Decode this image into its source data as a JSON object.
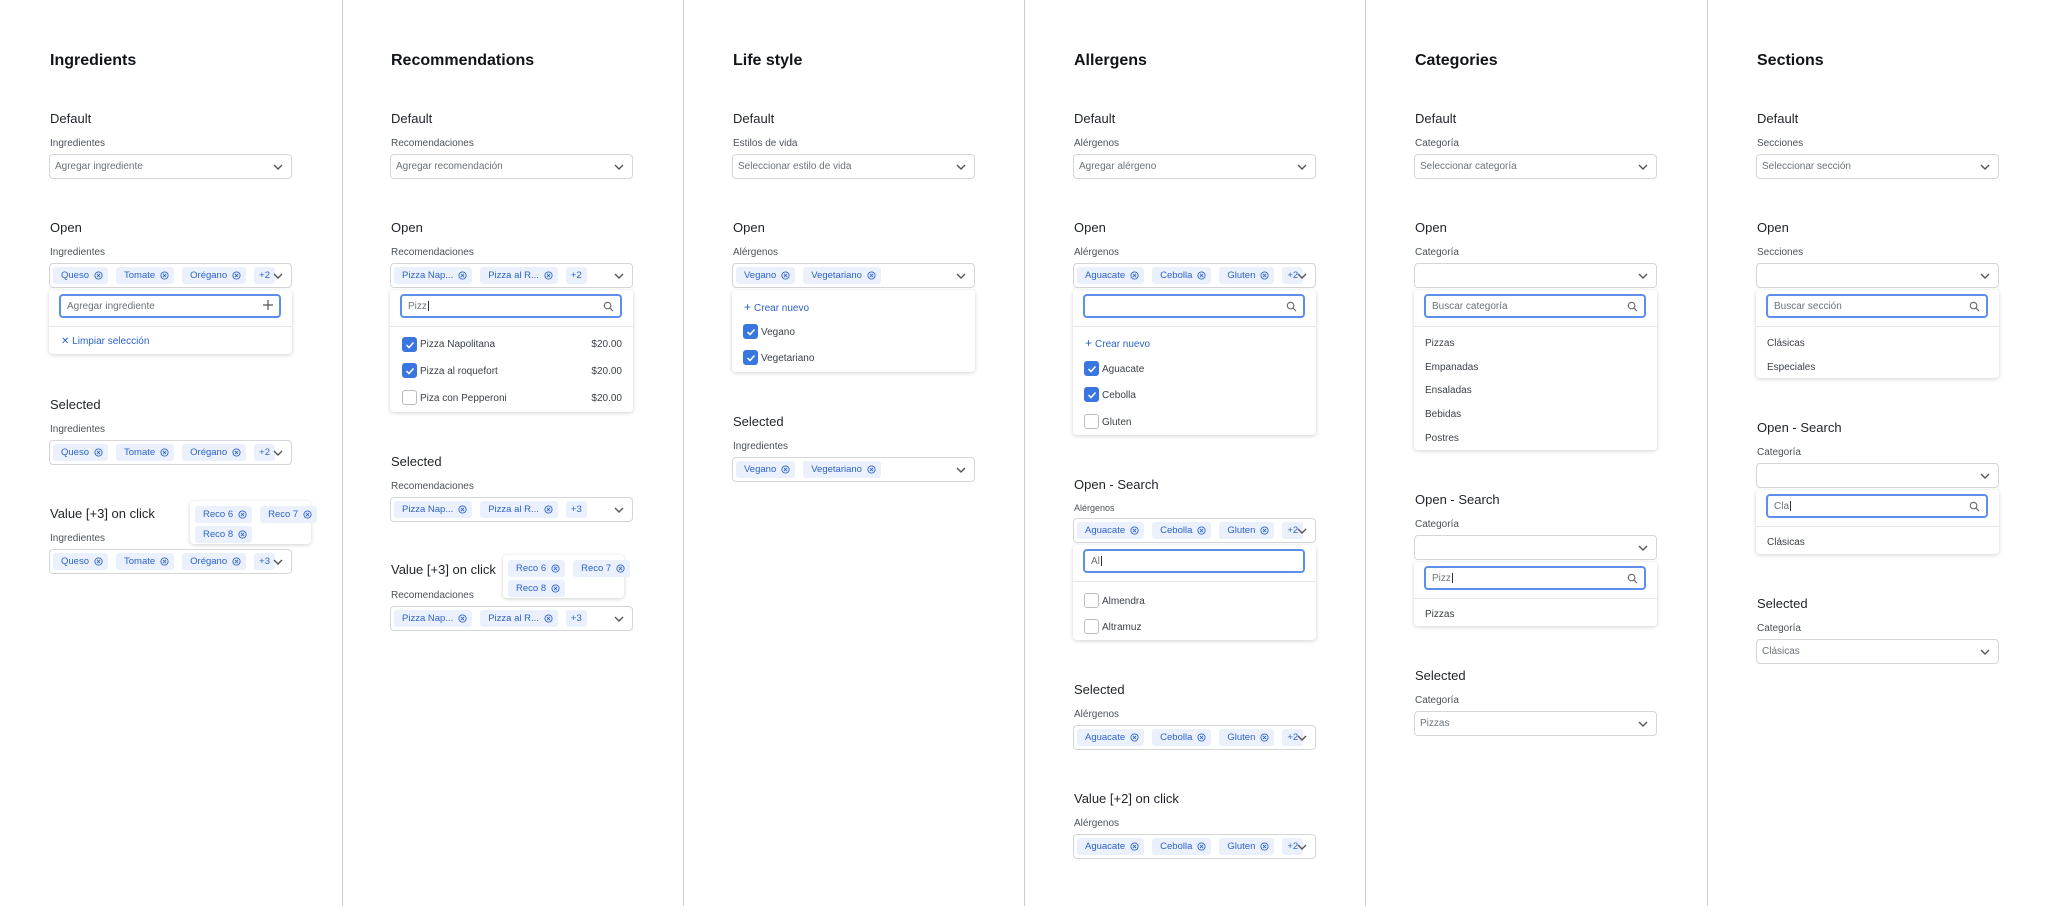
{
  "colors": {
    "accent": "#3a76e0",
    "chip_bg": "#eaf1fd",
    "chip_text": "#2d62c9",
    "divider": "#c9cdd2"
  },
  "icons": {
    "chevron": "chevron-down-icon",
    "chip_remove": "x-circle-icon",
    "search": "search-icon",
    "check": "check-icon",
    "plus": "plus-icon",
    "close": "close-icon"
  },
  "ingredients": {
    "title": "Ingredients",
    "default": {
      "heading": "Default",
      "label": "Ingredientes",
      "placeholder": "Agregar ingrediente"
    },
    "open": {
      "heading": "Open",
      "label": "Ingredientes",
      "chips": [
        "Queso",
        "Tomate",
        "Orégano"
      ],
      "more": "+2",
      "search_placeholder": "Agregar ingrediente",
      "clear": "Limpiar selección"
    },
    "selected": {
      "heading": "Selected",
      "label": "Ingredientes",
      "chips": [
        "Queso",
        "Tomate",
        "Orégano"
      ],
      "more": "+2"
    },
    "value_click": {
      "heading": "Value [+3] on click",
      "label": "Ingredientes",
      "chips": [
        "Queso",
        "Tomate",
        "Orégano"
      ],
      "more": "+3",
      "popover": [
        "Reco 6",
        "Reco 7",
        "Reco 8"
      ]
    }
  },
  "recommendations": {
    "title": "Recommendations",
    "default": {
      "heading": "Default",
      "label": "Recomendaciones",
      "placeholder": "Agregar recomendación"
    },
    "open": {
      "heading": "Open",
      "label": "Recomendaciones",
      "chips": [
        "Pizza Nap...",
        "Pizza al R..."
      ],
      "more": "+2",
      "search_typed": "Pizz",
      "options": [
        {
          "name": "Pizza Napolitana",
          "price": "$20.00",
          "checked": true
        },
        {
          "name": "Pizza al roquefort",
          "price": "$20.00",
          "checked": true
        },
        {
          "name": "Piza con Pepperoni",
          "price": "$20.00",
          "checked": false
        }
      ]
    },
    "selected": {
      "heading": "Selected",
      "label": "Recomendaciones",
      "chips": [
        "Pizza Nap...",
        "Pizza al R..."
      ],
      "more": "+3"
    },
    "value_click": {
      "heading": "Value [+3] on click",
      "label": "Recomendaciones",
      "chips": [
        "Pizza Nap...",
        "Pizza al R..."
      ],
      "more": "+3",
      "popover": [
        "Reco 6",
        "Reco 7",
        "Reco 8"
      ]
    }
  },
  "lifestyle": {
    "title": "Life style",
    "default": {
      "heading": "Default",
      "label": "Estilos de vida",
      "placeholder": "Seleccionar estilo de vida"
    },
    "open": {
      "heading": "Open",
      "label": "Alérgenos",
      "chips": [
        "Vegano",
        "Vegetariano"
      ],
      "create": "Crear nuevo",
      "options": [
        {
          "name": "Vegano",
          "checked": true
        },
        {
          "name": "Vegetariano",
          "checked": true
        }
      ]
    },
    "selected": {
      "heading": "Selected",
      "label": "Ingredientes",
      "chips": [
        "Vegano",
        "Vegetariano"
      ]
    }
  },
  "allergens": {
    "title": "Allergens",
    "default": {
      "heading": "Default",
      "label": "Alérgenos",
      "placeholder": "Agregar alérgeno"
    },
    "open": {
      "heading": "Open",
      "label": "Alérgenos",
      "chips": [
        "Aguacate",
        "Cebolla",
        "Gluten"
      ],
      "more": "+2",
      "create": "Crear nuevo",
      "options": [
        {
          "name": "Aguacate",
          "checked": true
        },
        {
          "name": "Cebolla",
          "checked": true
        },
        {
          "name": "Gluten",
          "checked": false
        }
      ]
    },
    "open_search": {
      "heading": "Open - Search",
      "label": "Alérgenos",
      "chips": [
        "Aguacate",
        "Cebolla",
        "Gluten"
      ],
      "more": "+2",
      "search_typed": "Al",
      "options": [
        {
          "name": "Almendra",
          "checked": false
        },
        {
          "name": "Altramuz",
          "checked": false
        }
      ]
    },
    "selected": {
      "heading": "Selected",
      "label": "Alérgenos",
      "chips": [
        "Aguacate",
        "Cebolla",
        "Gluten"
      ],
      "more": "+2"
    },
    "value_click": {
      "heading": "Value [+2] on click",
      "label": "Alérgenos",
      "chips": [
        "Aguacate",
        "Cebolla",
        "Gluten"
      ],
      "more": "+2"
    }
  },
  "categories": {
    "title": "Categories",
    "default": {
      "heading": "Default",
      "label": "Categoría",
      "placeholder": "Seleccionar categoría"
    },
    "open": {
      "heading": "Open",
      "label": "Categoría",
      "search_placeholder": "Buscar categoría",
      "options": [
        "Pizzas",
        "Empanadas",
        "Ensaladas",
        "Bebidas",
        "Postres"
      ]
    },
    "open_search": {
      "heading": "Open - Search",
      "label": "Categoría",
      "search_typed": "Pizz",
      "options": [
        "Pizzas"
      ]
    },
    "selected": {
      "heading": "Selected",
      "label": "Categoría",
      "value": "Pizzas"
    }
  },
  "sections": {
    "title": "Sections",
    "default": {
      "heading": "Default",
      "label": "Secciones",
      "placeholder": "Seleccionar sección"
    },
    "open": {
      "heading": "Open",
      "label": "Secciones",
      "search_placeholder": "Buscar sección",
      "options": [
        "Clásicas",
        "Especiales"
      ]
    },
    "open_search": {
      "heading": "Open - Search",
      "label": "Categoría",
      "search_typed": "Cla",
      "options": [
        "Clásicas"
      ]
    },
    "selected": {
      "heading": "Selected",
      "label": "Categoría",
      "value": "Clásicas"
    }
  }
}
